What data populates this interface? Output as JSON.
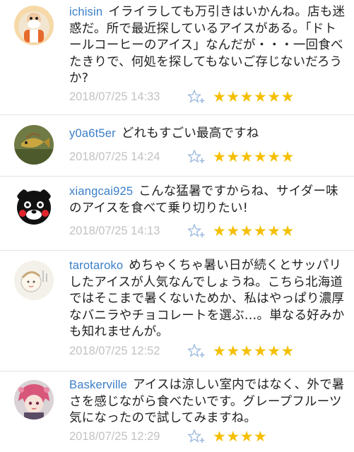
{
  "comments": [
    {
      "username": "ichisin",
      "text": "イライラしても万引きはいかんね。店も迷惑だ。所で最近探しているアイスがある。「ドトールコーヒーのアイス」なんだが・・・一回食べたきりで、何処を探してもないご存じないだろうか?",
      "date": "2018/07/25 14:33",
      "stars": "★★★★★★",
      "avatar_icon": "cartoon-old-man-avatar-icon"
    },
    {
      "username": "y0a6t5er",
      "text": "どれもすごい最高ですね",
      "date": "2018/07/25 14:24",
      "stars": "★★★★★★",
      "avatar_icon": "fish-photo-avatar-icon"
    },
    {
      "username": "xiangcai925",
      "text": "こんな猛暑ですからね、サイダー味のアイスを食べて乗り切りたい!",
      "date": "2018/07/25 14:13",
      "stars": "★★★★★★",
      "avatar_icon": "kumamon-bear-avatar-icon"
    },
    {
      "username": "tarotaroko",
      "text": "めちゃくちゃ暑い日が続くとサッパリしたアイスが人気なんでしょうね。こちら北海道ではそこまで暑くないためか、私はやっぱり濃厚なバニラやチョコレートを選ぶ…。単なる好みかも知れませんが。",
      "date": "2018/07/25 12:52",
      "stars": "★★★★★★",
      "avatar_icon": "child-drawing-avatar-icon"
    },
    {
      "username": "Baskerville",
      "text": "アイスは涼しい室内ではなく、外で暑さを感じながら食べたいです。グレープフルーツ気になったので試してみますね。",
      "date": "2018/07/25 12:29",
      "stars": "★★★★",
      "avatar_icon": "anime-character-avatar-icon"
    }
  ],
  "colors": {
    "username": "#3a7ec8",
    "date": "#c2c2c2",
    "star": "#f5bf00",
    "like_icon": "#9bb8de",
    "divider": "#e3e3e3"
  },
  "like_icon": "star-plus-icon"
}
